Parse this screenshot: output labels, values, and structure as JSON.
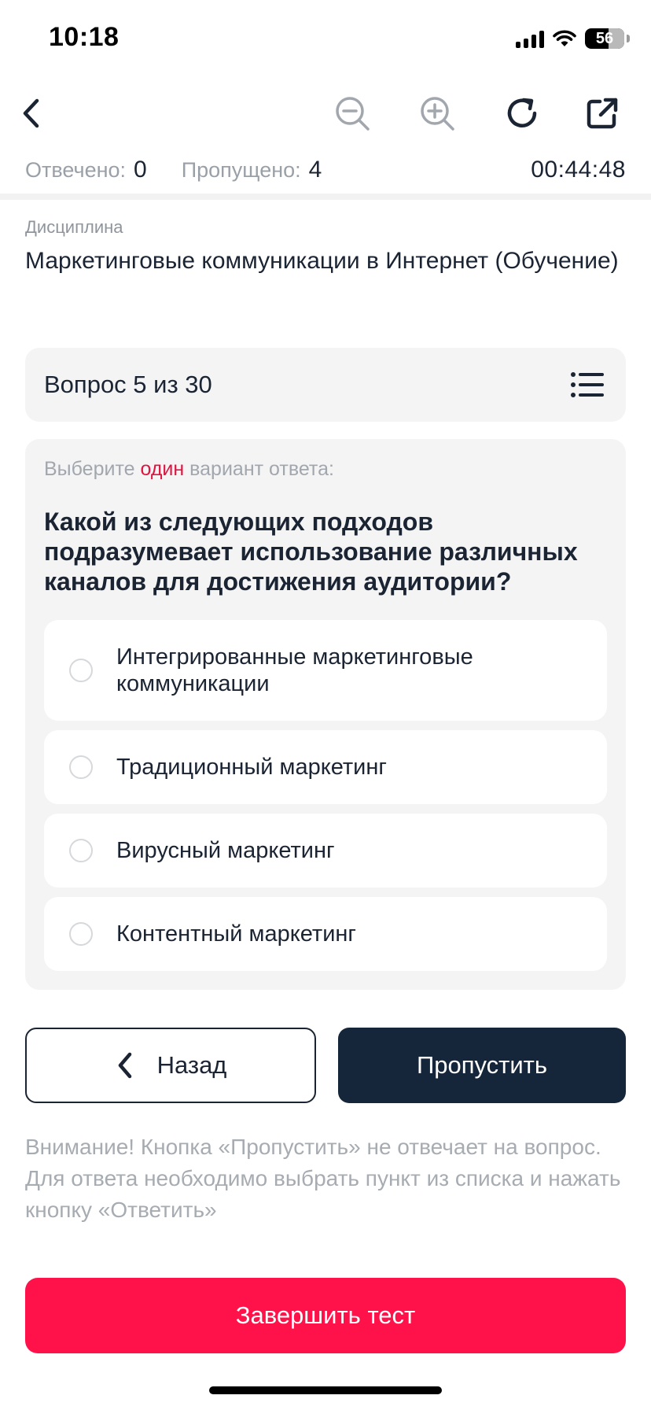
{
  "status_bar": {
    "time": "10:18",
    "battery": "56"
  },
  "toolbar": {
    "icons": [
      "back-icon",
      "zoom-out-icon",
      "zoom-in-icon",
      "refresh-icon",
      "share-icon"
    ]
  },
  "counters": {
    "answered_label": "Отвечено:",
    "answered_value": "0",
    "skipped_label": "Пропущено:",
    "skipped_value": "4",
    "timer": "00:44:48"
  },
  "discipline": {
    "label": "Дисциплина",
    "title": "Маркетинговые коммуникации в Интернет (Обучение)"
  },
  "question": {
    "counter": "Вопрос 5 из 30",
    "instruction_before": "Выберите ",
    "instruction_accent": "один",
    "instruction_after": " вариант ответа:",
    "text": "Какой из следующих подходов подразумевает использование различных каналов для достижения аудитории?",
    "options": [
      "Интегрированные маркетинговые коммуникации",
      "Традиционный маркетинг",
      "Вирусный маркетинг",
      "Контентный маркетинг"
    ]
  },
  "nav": {
    "back_label": "Назад",
    "skip_label": "Пропустить"
  },
  "warning": "Внимание! Кнопка «Пропустить» не отвечает на вопрос. Для ответа необходимо выбрать пункт из списка и нажать кнопку «Ответить»",
  "finish_label": "Завершить тест",
  "colors": {
    "primary_dark": "#16263a",
    "accent_red": "#ff1249",
    "card_bg": "#f4f4f5",
    "muted_text": "#a7acb2"
  }
}
